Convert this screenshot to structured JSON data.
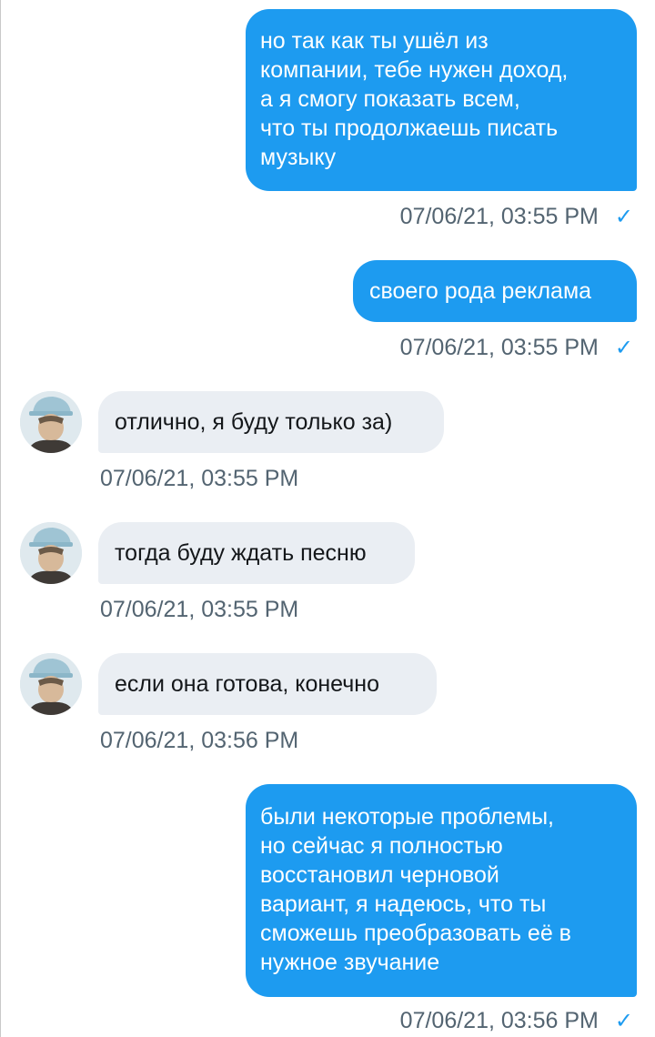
{
  "colors": {
    "outgoing_bubble": "#1d9bf0",
    "incoming_bubble": "#eaeef3",
    "timestamp": "#536471",
    "read_check": "#1d9bf0"
  },
  "icons": {
    "read": "checkmark-icon",
    "avatar": "user-avatar"
  },
  "messages": [
    {
      "direction": "outgoing",
      "lines": [
        "но так как ты ушёл из",
        "компании, тебе нужен доход,",
        "а я смогу показать всем,",
        "что ты продолжаешь писать",
        "музыку"
      ],
      "time": "07/06/21, 03:55 PM",
      "check": "✓"
    },
    {
      "direction": "outgoing",
      "lines": [
        "своего рода реклама"
      ],
      "time": "07/06/21, 03:55 PM",
      "check": "✓"
    },
    {
      "direction": "incoming",
      "lines": [
        "отлично, я буду только за)"
      ],
      "time": "07/06/21, 03:55 PM"
    },
    {
      "direction": "incoming",
      "lines": [
        "тогда буду ждать песню"
      ],
      "time": "07/06/21, 03:55 PM"
    },
    {
      "direction": "incoming",
      "lines": [
        "если она готова, конечно"
      ],
      "time": "07/06/21, 03:56 PM"
    },
    {
      "direction": "outgoing",
      "lines": [
        "были некоторые проблемы,",
        "но сейчас я полностью",
        "восстановил черновой",
        "вариант, я надеюсь, что ты",
        "сможешь преобразовать её в",
        "нужное звучание"
      ],
      "time": "07/06/21, 03:56 PM",
      "check": "✓"
    }
  ]
}
